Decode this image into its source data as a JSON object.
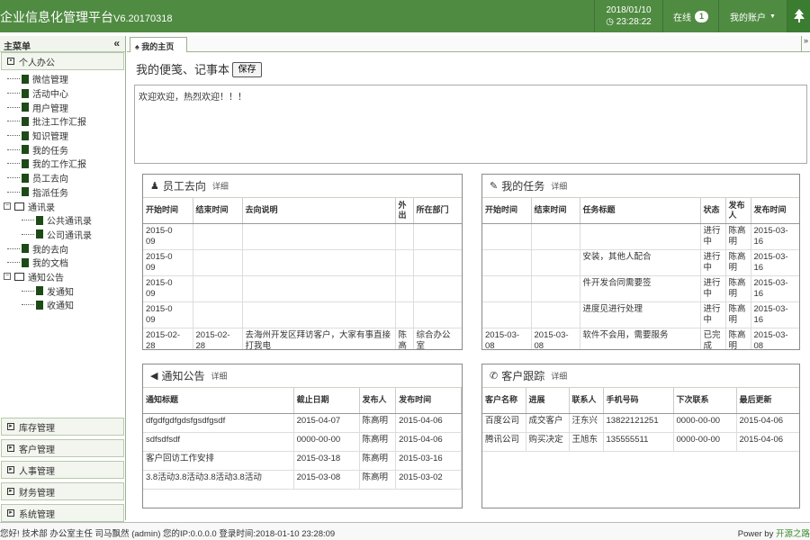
{
  "header": {
    "title": "企业信息化管理平台",
    "version": "V6.20170318",
    "date": "2018/01/10",
    "time": "23:28:22",
    "online_label": "在线",
    "online_count": "1",
    "account_label": "我的账户"
  },
  "sidebar": {
    "title": "主菜单",
    "collapse_glyph": "«",
    "section": "个人办公",
    "items": [
      {
        "label": "微信管理",
        "level": 1,
        "kind": "doc"
      },
      {
        "label": "活动中心",
        "level": 1,
        "kind": "doc"
      },
      {
        "label": "用户管理",
        "level": 1,
        "kind": "doc"
      },
      {
        "label": "批注工作汇报",
        "level": 1,
        "kind": "doc"
      },
      {
        "label": "知识管理",
        "level": 1,
        "kind": "doc"
      },
      {
        "label": "我的任务",
        "level": 1,
        "kind": "doc"
      },
      {
        "label": "我的工作汇报",
        "level": 1,
        "kind": "doc"
      },
      {
        "label": "员工去向",
        "level": 1,
        "kind": "doc"
      },
      {
        "label": "指派任务",
        "level": 1,
        "kind": "doc"
      },
      {
        "label": "通讯录",
        "level": 0,
        "kind": "folder"
      },
      {
        "label": "公共通讯录",
        "level": 2,
        "kind": "doc"
      },
      {
        "label": "公司通讯录",
        "level": 2,
        "kind": "doc"
      },
      {
        "label": "我的去向",
        "level": 1,
        "kind": "doc"
      },
      {
        "label": "我的文档",
        "level": 1,
        "kind": "doc"
      },
      {
        "label": "通知公告",
        "level": 0,
        "kind": "folder"
      },
      {
        "label": "发通知",
        "level": 2,
        "kind": "doc"
      },
      {
        "label": "收通知",
        "level": 2,
        "kind": "doc"
      }
    ],
    "bottom": [
      "库存管理",
      "客户管理",
      "人事管理",
      "财务管理",
      "系统管理"
    ]
  },
  "tabs": {
    "home": "我的主页",
    "more": "»"
  },
  "memo": {
    "title": "我的便笺、记事本",
    "save": "保存",
    "content": "欢迎欢迎，热烈欢迎！！！"
  },
  "panels": {
    "staff": {
      "title": "员工去向",
      "detail": "详细",
      "headers": [
        "开始时间",
        "结束时间",
        "去向说明",
        "外出",
        "所在部门"
      ],
      "rows": [
        [
          "2015-0\n09",
          "",
          "",
          "",
          ""
        ],
        [
          "2015-0\n09",
          "",
          "",
          "",
          ""
        ],
        [
          "2015-0\n09",
          "",
          "",
          "",
          ""
        ],
        [
          "2015-0\n09",
          "",
          "",
          "",
          ""
        ],
        [
          "2015-02-\n28",
          "2015-02-\n28",
          "去海州开发区拜访客户，大家有事直接打我电",
          "陈高\n明",
          "综合办公\n室"
        ]
      ]
    },
    "tasks": {
      "title": "我的任务",
      "detail": "详细",
      "headers": [
        "开始时间",
        "结束时间",
        "任务标题",
        "状态",
        "发布人",
        "发布时间"
      ],
      "rows": [
        [
          "",
          "",
          "",
          "进行\n中",
          "陈高\n明",
          "2015-03-\n16"
        ],
        [
          "",
          "",
          "安装，其他人配合",
          "进行\n中",
          "陈高\n明",
          "2015-03-\n16"
        ],
        [
          "",
          "",
          "件开发合同需要签",
          "进行\n中",
          "陈高\n明",
          "2015-03-\n16"
        ],
        [
          "",
          "",
          "进度见进行处理",
          "进行\n中",
          "陈高\n明",
          "2015-03-\n16"
        ],
        [
          "2015-03-\n08",
          "2015-03-\n08",
          "软件不会用，需要服务",
          "已完\n成",
          "陈高\n明",
          "2015-03-\n08"
        ]
      ]
    },
    "notice": {
      "title": "通知公告",
      "detail": "详细",
      "headers": [
        "通知标题",
        "截止日期",
        "发布人",
        "发布时间"
      ],
      "rows": [
        [
          "dfgdfgdfgdsfgsdfgsdf",
          "2015-04-07",
          "陈高明",
          "2015-04-06"
        ],
        [
          "sdfsdfsdf",
          "0000-00-00",
          "陈高明",
          "2015-04-06"
        ],
        [
          "客户回访工作安排",
          "2015-03-18",
          "陈高明",
          "2015-03-16"
        ],
        [
          "3.8活动3.8活动3.8活动3.8活动",
          "2015-03-08",
          "陈高明",
          "2015-03-02"
        ]
      ]
    },
    "customers": {
      "title": "客户跟踪",
      "detail": "详细",
      "headers": [
        "客户名称",
        "进展",
        "联系人",
        "手机号码",
        "下次联系",
        "最后更新"
      ],
      "rows": [
        [
          "百度公司",
          "成交客户",
          "汪东兴",
          "13822121251",
          "0000-00-00",
          "2015-04-06"
        ],
        [
          "腾讯公司",
          "购买决定",
          "王旭东",
          "135555511",
          "0000-00-00",
          "2015-04-06"
        ]
      ]
    }
  },
  "footer": {
    "status": "您好! 技术部 办公室主任 司马飘然 (admin) 您的IP:0.0.0.0 登录时间:2018-01-10 23:28:09",
    "power_label": "Power by",
    "power_link": "开源之路"
  },
  "colors": {
    "brand": "#4f8b41",
    "tree_icon": "#1d4a16",
    "link": "#3a8a2a"
  },
  "icons": [
    "user-icon",
    "edit-icon",
    "volume-icon",
    "phone-icon",
    "tree-icon",
    "home-icon",
    "caret-down-icon",
    "collapse-icon"
  ]
}
